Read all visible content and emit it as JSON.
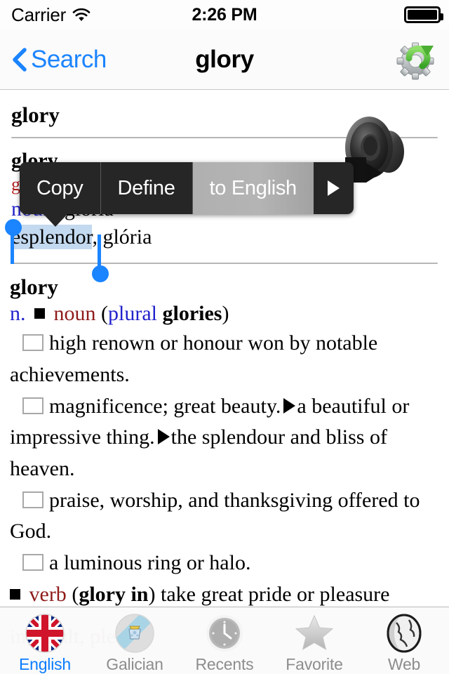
{
  "status_bar": {
    "carrier": "Carrier",
    "wifi_icon": "wifi-icon",
    "time": "2:26 PM",
    "battery_icon": "battery-full-icon"
  },
  "nav_bar": {
    "back_icon": "chevron-left-icon",
    "back_label": "Search",
    "title": "glory",
    "action_icon": "gear-refresh-icon"
  },
  "entry": {
    "headword": "glory",
    "translation_headword": "glory",
    "translation_red": "gloria",
    "pos_label": "noun",
    "pos_sep": ":",
    "translation_first": "gloria",
    "translation_second_selected": "esplendor",
    "translation_second_rest": ", glória",
    "speaker_icon": "speaker-audio-icon"
  },
  "callout": {
    "items": [
      {
        "label": "Copy",
        "name": "copy-menu-item",
        "state": "normal"
      },
      {
        "label": "Define",
        "name": "define-menu-item",
        "state": "normal"
      },
      {
        "label": "to English",
        "name": "to-english-menu-item",
        "state": "active"
      }
    ],
    "more_icon": "triangle-right-icon"
  },
  "definition": {
    "headword": "glory",
    "abbrev": "n.",
    "bullet_icon": "black-square-bullet",
    "pos": "noun",
    "plural_label": "plural",
    "plural_form": "glories",
    "paren_open": "(",
    "paren_close": ")",
    "senses": [
      {
        "text": "high renown or honour won by notable achievements."
      },
      {
        "text": "magnificence; great beauty."
      },
      {
        "text": "praise, worship, and thanksgiving offered to God."
      },
      {
        "text": "a luminous ring or halo."
      }
    ],
    "subsense_a": "a beautiful or impressive thing.",
    "subsense_b": "the splendour and bliss of heaven.",
    "verb_pos": "verb",
    "verb_phrase": "glory in",
    "verb_text": "take great pride or pleasure",
    "ghost_text": "in; exult,            pleas"
  },
  "tab_bar": {
    "tabs": [
      {
        "label": "English",
        "icon": "uk-flag-icon",
        "selected": true
      },
      {
        "label": "Galician",
        "icon": "galicia-flag-icon",
        "selected": false
      },
      {
        "label": "Recents",
        "icon": "clock-icon",
        "selected": false
      },
      {
        "label": "Favorite",
        "icon": "star-icon",
        "selected": false
      },
      {
        "label": "Web",
        "icon": "globe-icon",
        "selected": false
      }
    ]
  },
  "colors": {
    "accent_blue": "#0a7cff",
    "link_blue": "#1b84ff",
    "pos_red": "#8f1b1b",
    "pos_blue": "#2222cc",
    "selection_highlight": "#c3d9ef",
    "menu_dark": "#262626"
  }
}
